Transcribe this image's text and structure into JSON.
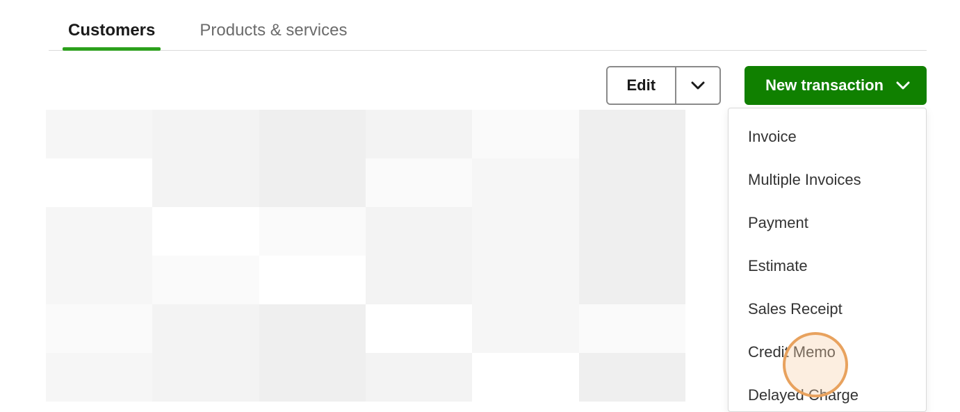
{
  "tabs": [
    {
      "label": "Customers",
      "active": true
    },
    {
      "label": "Products & services",
      "active": false
    }
  ],
  "actions": {
    "edit_label": "Edit",
    "new_transaction_label": "New transaction"
  },
  "dropdown": {
    "items": [
      "Invoice",
      "Multiple Invoices",
      "Payment",
      "Estimate",
      "Sales Receipt",
      "Credit Memo",
      "Delayed Charge"
    ]
  }
}
